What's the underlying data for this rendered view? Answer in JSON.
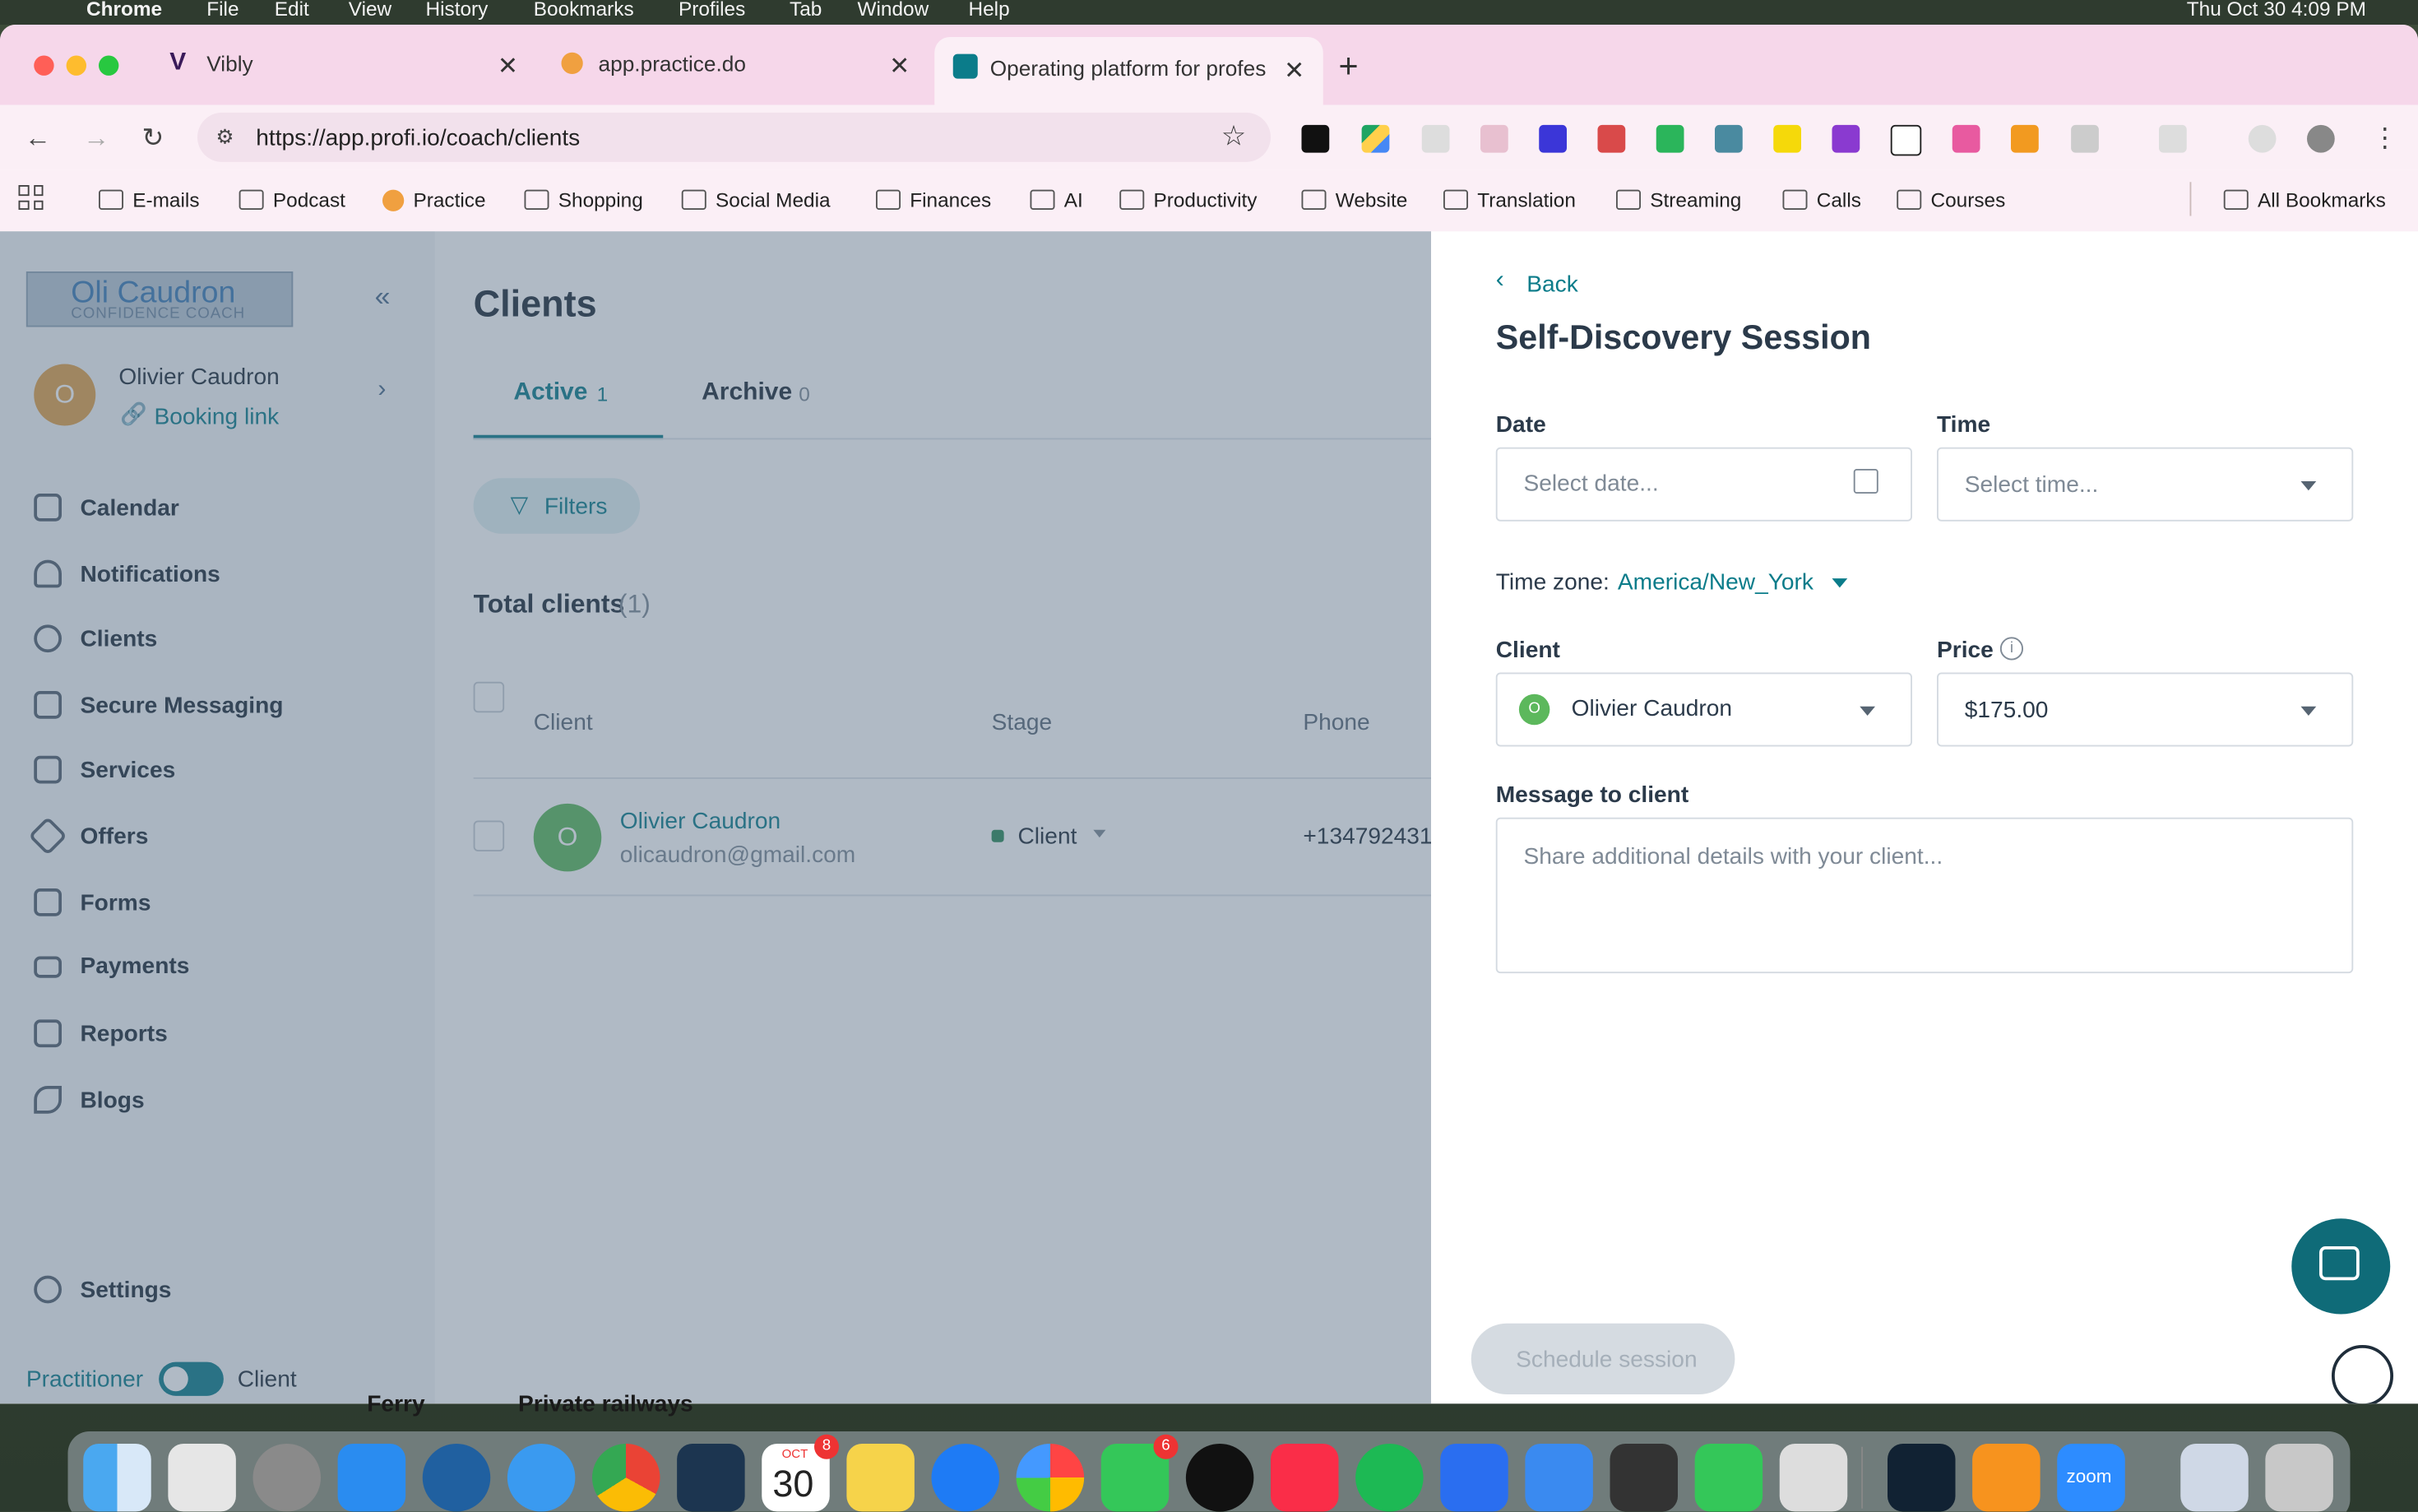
{
  "menubar": {
    "app": "Chrome",
    "items": [
      "File",
      "Edit",
      "View",
      "History",
      "Bookmarks",
      "Profiles",
      "Tab",
      "Window",
      "Help"
    ],
    "clock": "Thu Oct 30  4:09 PM"
  },
  "browser": {
    "tabs": [
      {
        "title": "Vibly"
      },
      {
        "title": "app.practice.do"
      },
      {
        "title": "Operating platform for profes"
      }
    ],
    "url": "https://app.profi.io/coach/clients",
    "bookmarks": [
      "E-mails",
      "Podcast",
      "Practice",
      "Shopping",
      "Social Media",
      "Finances",
      "AI",
      "Productivity",
      "Website",
      "Translation",
      "Streaming",
      "Calls",
      "Courses"
    ],
    "all_bookmarks": "All Bookmarks"
  },
  "sidebar": {
    "logo_name": "Oli Caudron",
    "logo_tagline": "CONFIDENCE COACH",
    "user_initial": "O",
    "user_name": "Olivier Caudron",
    "booking_link": "Booking link",
    "items": [
      {
        "label": "Calendar",
        "icon": "calendar-icon"
      },
      {
        "label": "Notifications",
        "icon": "bell-icon"
      },
      {
        "label": "Clients",
        "icon": "users-icon"
      },
      {
        "label": "Secure Messaging",
        "icon": "chat-icon"
      },
      {
        "label": "Services",
        "icon": "grid-icon"
      },
      {
        "label": "Offers",
        "icon": "tag-icon"
      },
      {
        "label": "Forms",
        "icon": "document-icon"
      },
      {
        "label": "Payments",
        "icon": "card-icon"
      },
      {
        "label": "Reports",
        "icon": "report-icon"
      },
      {
        "label": "Blogs",
        "icon": "quill-icon"
      }
    ],
    "settings": "Settings",
    "toggle_left": "Practitioner",
    "toggle_right": "Client"
  },
  "clients": {
    "title": "Clients",
    "tabs": [
      {
        "label": "Active",
        "count": "1"
      },
      {
        "label": "Archive",
        "count": "0"
      }
    ],
    "filters": "Filters",
    "total_label": "Total clients",
    "total_count": "(1)",
    "columns": [
      "Client",
      "Stage",
      "Phone"
    ],
    "rows": [
      {
        "initial": "O",
        "name": "Olivier Caudron",
        "email": "olicaudron@gmail.com",
        "stage": "Client",
        "phone": "+134792431"
      }
    ]
  },
  "panel": {
    "back": "Back",
    "title": "Self-Discovery Session",
    "date_label": "Date",
    "date_placeholder": "Select date...",
    "time_label": "Time",
    "time_placeholder": "Select time...",
    "timezone_label": "Time zone:",
    "timezone_value": "America/New_York",
    "client_label": "Client",
    "client_initial": "O",
    "client_value": "Olivier Caudron",
    "price_label": "Price",
    "price_value": "$175.00",
    "message_label": "Message to client",
    "message_placeholder": "Share additional details with your client...",
    "schedule_button": "Schedule session"
  },
  "background_text": {
    "a": "Ferry",
    "b": "Private railways"
  },
  "dock": {
    "calendar_month": "OCT",
    "calendar_day": "30",
    "calendar_badge": "8",
    "facetime_badge": "6",
    "zoom": "zoom"
  },
  "colors": {
    "accent": "#0b7c8a",
    "sidebar_bg": "#f4f6f8",
    "overlay": "#50677e",
    "avatar_orange": "#e0a04a",
    "avatar_green": "#5cb85c"
  }
}
